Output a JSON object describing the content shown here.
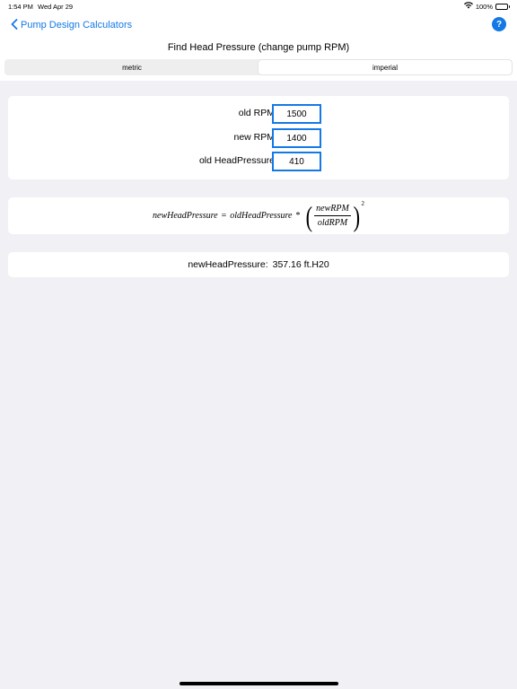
{
  "status_bar": {
    "time": "1:54 PM",
    "date": "Wed Apr 29",
    "battery": "100%"
  },
  "nav": {
    "back_label": "Pump Design Calculators",
    "help_label": "?"
  },
  "page": {
    "title": "Find Head Pressure (change pump RPM)"
  },
  "units": {
    "options": [
      "metric",
      "imperial"
    ],
    "selected": "imperial"
  },
  "inputs": [
    {
      "label": "old RPM",
      "value": "1500"
    },
    {
      "label": "new RPM",
      "value": "1400"
    },
    {
      "label": "old HeadPressure",
      "value": "410"
    }
  ],
  "formula": {
    "lhs": "newHeadPressure",
    "equals": "=",
    "rhs_term": "oldHeadPressure",
    "times": "*",
    "numerator": "newRPM",
    "denominator": "oldRPM",
    "exponent": "2"
  },
  "result": {
    "label": "newHeadPressure:",
    "value": "357.16 ft.H20"
  },
  "colors": {
    "accent": "#1479e5",
    "background": "#f0f0f5",
    "card": "#ffffff"
  }
}
